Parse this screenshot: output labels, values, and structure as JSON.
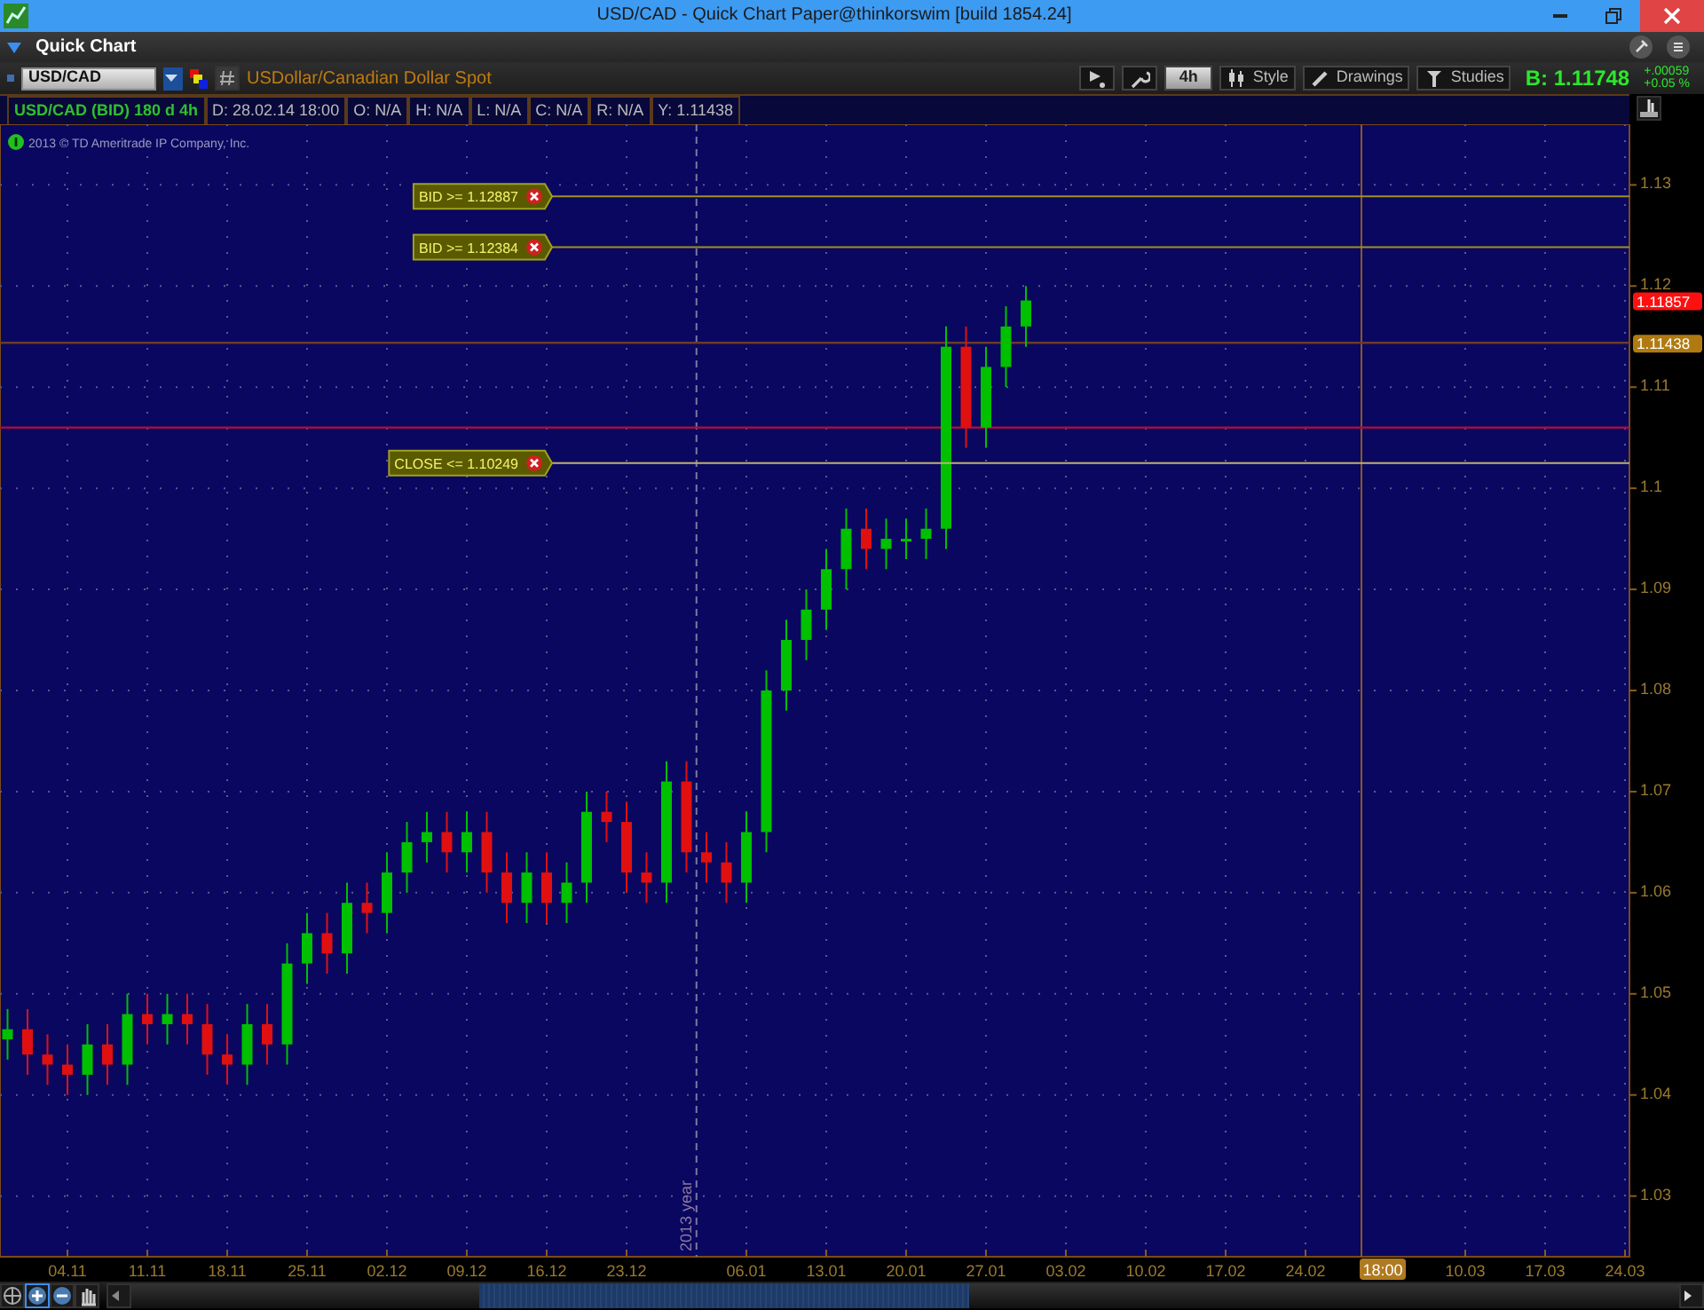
{
  "window": {
    "title": "USD/CAD - Quick Chart Paper@thinkorswim [build 1854.24]"
  },
  "panel": {
    "title": "Quick Chart"
  },
  "toolbar": {
    "symbol": "USD/CAD",
    "description": "USDollar/Canadian Dollar Spot",
    "buttons": [
      {
        "kind": "cursor"
      },
      {
        "kind": "settings"
      },
      {
        "kind": "aggregation",
        "label": "4h"
      },
      {
        "kind": "style",
        "label": "Style"
      },
      {
        "kind": "drawings",
        "label": "Drawings"
      },
      {
        "kind": "studies",
        "label": "Studies"
      }
    ],
    "quote": "B: 1.11748",
    "change": "+.00059",
    "change_percent": "+0.05 %"
  },
  "info_bar": [
    {
      "kind": "title",
      "text": "USD/CAD (BID) 180 d 4h"
    },
    {
      "kind": "field",
      "text": "D: 28.02.14 18:00"
    },
    {
      "kind": "field",
      "text": "O: N/A"
    },
    {
      "kind": "field",
      "text": "H: N/A"
    },
    {
      "kind": "field",
      "text": "L: N/A"
    },
    {
      "kind": "field",
      "text": "C: N/A"
    },
    {
      "kind": "field",
      "text": "R: N/A"
    },
    {
      "kind": "field",
      "text": "Y: 1.11438"
    }
  ],
  "chart": {
    "copyright": "2013 © TD Ameritrade IP Company, Inc.",
    "year_label": "2013 year",
    "time_marker": "18:00",
    "chart_data": {
      "type": "candlestick",
      "ylim": [
        1.024,
        1.136
      ],
      "yticks": [
        1.03,
        1.04,
        1.05,
        1.06,
        1.07,
        1.08,
        1.09,
        {
          "value": 1.1,
          "label": "1.1"
        },
        1.11,
        1.12,
        1.13
      ],
      "categories": [
        null,
        null,
        null,
        "04.11",
        null,
        null,
        null,
        "11.11",
        null,
        null,
        null,
        "18.11",
        null,
        null,
        null,
        "25.11",
        null,
        null,
        null,
        "02.12",
        null,
        null,
        null,
        "09.12",
        null,
        null,
        null,
        "16.12",
        null,
        null,
        null,
        "23.12",
        null,
        null,
        null,
        null,
        null,
        "06.01",
        null,
        null,
        null,
        "13.01",
        null,
        null,
        null,
        "20.01",
        null,
        null,
        null,
        "27.01",
        null,
        null,
        null,
        "03.02",
        null,
        null,
        null,
        "10.02",
        null,
        null,
        null,
        "17.02",
        null,
        null,
        null,
        "24.02",
        null,
        null,
        null,
        null,
        null,
        null,
        null,
        "10.03",
        null,
        null,
        null,
        "17.03",
        null,
        null,
        null,
        "24.03"
      ],
      "ohlc": [
        [
          1.0455,
          1.0485,
          1.0435,
          1.0465
        ],
        [
          1.0465,
          1.0485,
          1.042,
          1.044
        ],
        [
          1.044,
          1.046,
          1.041,
          1.043
        ],
        [
          1.043,
          1.045,
          1.04,
          1.042
        ],
        [
          1.042,
          1.047,
          1.04,
          1.045
        ],
        [
          1.045,
          1.047,
          1.041,
          1.043
        ],
        [
          1.043,
          1.05,
          1.041,
          1.048
        ],
        [
          1.048,
          1.05,
          1.045,
          1.047
        ],
        [
          1.047,
          1.05,
          1.045,
          1.048
        ],
        [
          1.048,
          1.05,
          1.045,
          1.047
        ],
        [
          1.047,
          1.049,
          1.042,
          1.044
        ],
        [
          1.044,
          1.046,
          1.041,
          1.043
        ],
        [
          1.043,
          1.049,
          1.041,
          1.047
        ],
        [
          1.047,
          1.049,
          1.043,
          1.045
        ],
        [
          1.045,
          1.055,
          1.043,
          1.053
        ],
        [
          1.053,
          1.058,
          1.051,
          1.056
        ],
        [
          1.056,
          1.058,
          1.052,
          1.054
        ],
        [
          1.054,
          1.061,
          1.052,
          1.059
        ],
        [
          1.059,
          1.061,
          1.056,
          1.058
        ],
        [
          1.058,
          1.064,
          1.056,
          1.062
        ],
        [
          1.062,
          1.067,
          1.06,
          1.065
        ],
        [
          1.065,
          1.068,
          1.063,
          1.066
        ],
        [
          1.066,
          1.068,
          1.062,
          1.064
        ],
        [
          1.064,
          1.068,
          1.062,
          1.066
        ],
        [
          1.066,
          1.068,
          1.06,
          1.062
        ],
        [
          1.062,
          1.064,
          1.057,
          1.059
        ],
        [
          1.059,
          1.064,
          1.057,
          1.062
        ],
        [
          1.062,
          1.064,
          1.057,
          1.059
        ],
        [
          1.059,
          1.063,
          1.057,
          1.061
        ],
        [
          1.061,
          1.07,
          1.059,
          1.068
        ],
        [
          1.068,
          1.07,
          1.065,
          1.067
        ],
        [
          1.067,
          1.069,
          1.06,
          1.062
        ],
        [
          1.062,
          1.064,
          1.059,
          1.061
        ],
        [
          1.061,
          1.073,
          1.059,
          1.071
        ],
        [
          1.071,
          1.073,
          1.062,
          1.064
        ],
        [
          1.064,
          1.066,
          1.061,
          1.063
        ],
        [
          1.063,
          1.065,
          1.059,
          1.061
        ],
        [
          1.061,
          1.068,
          1.059,
          1.066
        ],
        [
          1.066,
          1.082,
          1.064,
          1.08
        ],
        [
          1.08,
          1.087,
          1.078,
          1.085
        ],
        [
          1.085,
          1.09,
          1.083,
          1.088
        ],
        [
          1.088,
          1.094,
          1.086,
          1.092
        ],
        [
          1.092,
          1.098,
          1.09,
          1.096
        ],
        [
          1.096,
          1.098,
          1.092,
          1.094
        ],
        [
          1.094,
          1.097,
          1.092,
          1.095
        ],
        [
          1.095,
          1.097,
          1.093,
          1.095
        ],
        [
          1.095,
          1.098,
          1.093,
          1.096
        ],
        [
          1.096,
          1.116,
          1.094,
          1.114
        ],
        [
          1.114,
          1.116,
          1.104,
          1.106
        ],
        [
          1.106,
          1.114,
          1.104,
          1.112
        ],
        [
          1.112,
          1.118,
          1.11,
          1.116
        ],
        [
          1.116,
          1.12,
          1.114,
          1.11857
        ],
        null,
        null,
        null,
        null,
        null,
        null,
        null,
        null,
        null,
        null,
        null,
        null,
        null,
        null,
        null,
        null,
        null,
        null,
        null,
        null,
        null,
        null,
        null,
        null,
        null,
        null,
        null,
        null,
        null,
        null
      ],
      "grid": true,
      "ref_lines": [
        {
          "axis": "y",
          "label": "BID >= 1.12887",
          "value": 1.12887,
          "color": "#a09020"
        },
        {
          "axis": "y",
          "label": "BID >= 1.12384",
          "value": 1.12384,
          "color": "#a09020"
        },
        {
          "axis": "y",
          "value": 1.11438,
          "color": "#6b3a2a"
        },
        {
          "axis": "y",
          "value": 1.106,
          "color": "#a01040"
        },
        {
          "axis": "y",
          "label": "CLOSE <= 1.10249",
          "value": 1.10249,
          "color": "#c0b070"
        }
      ],
      "annotations": [
        "1.11857",
        "1.11438"
      ]
    },
    "price_tags": [
      {
        "color": "#ff1010"
      },
      {
        "color": "#b07a10"
      }
    ]
  }
}
